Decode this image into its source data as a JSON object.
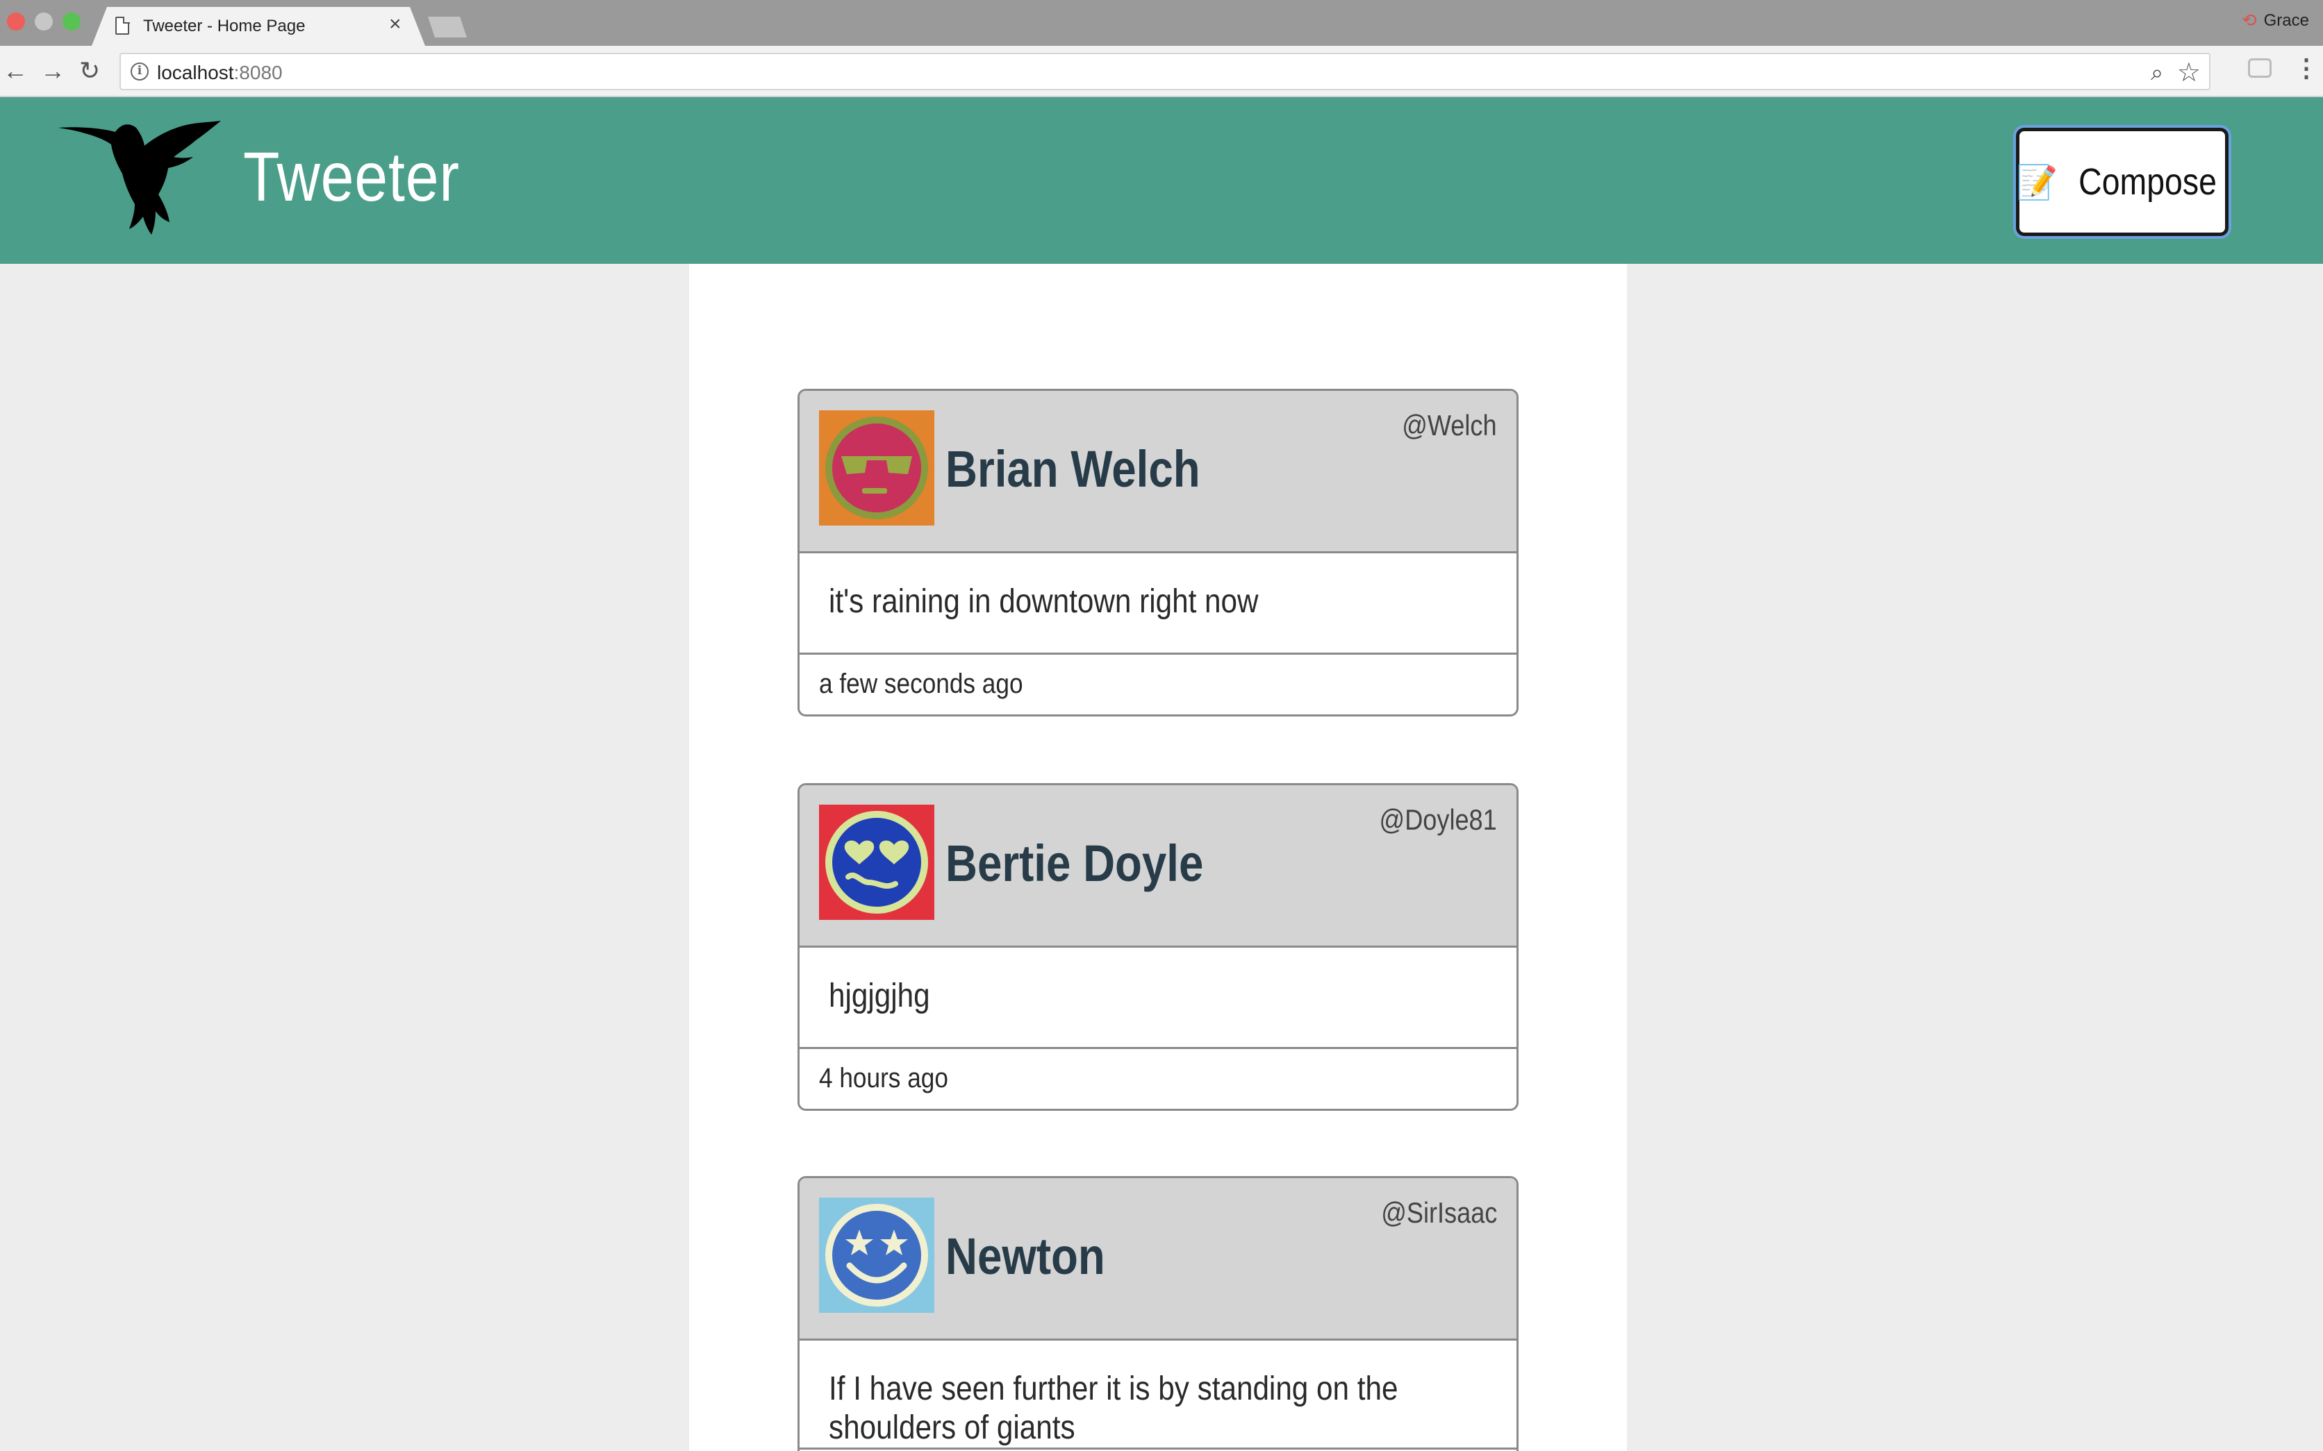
{
  "browser": {
    "tab_title": "Tweeter - Home Page",
    "tab_close": "×",
    "url_host": "localhost",
    "url_port": ":8080",
    "profile_name": "Grace"
  },
  "header": {
    "app_title": "Tweeter",
    "compose_label": "Compose",
    "compose_icon": "📝",
    "background_color": "#4a9e8a"
  },
  "tweets": [
    {
      "name": "Brian Welch",
      "handle": "@Welch",
      "content": "it's raining in downtown right now",
      "time": "a few seconds ago",
      "avatar": "sunglasses-face-icon"
    },
    {
      "name": "Bertie Doyle",
      "handle": "@Doyle81",
      "content": "hjgjgjhg",
      "time": "4 hours ago",
      "avatar": "heart-eyes-face-icon"
    },
    {
      "name": "Newton",
      "handle": "@SirIsaac",
      "content": "If I have seen further it is by standing on the shoulders of giants",
      "time": "",
      "avatar": "star-eyes-face-icon"
    }
  ]
}
